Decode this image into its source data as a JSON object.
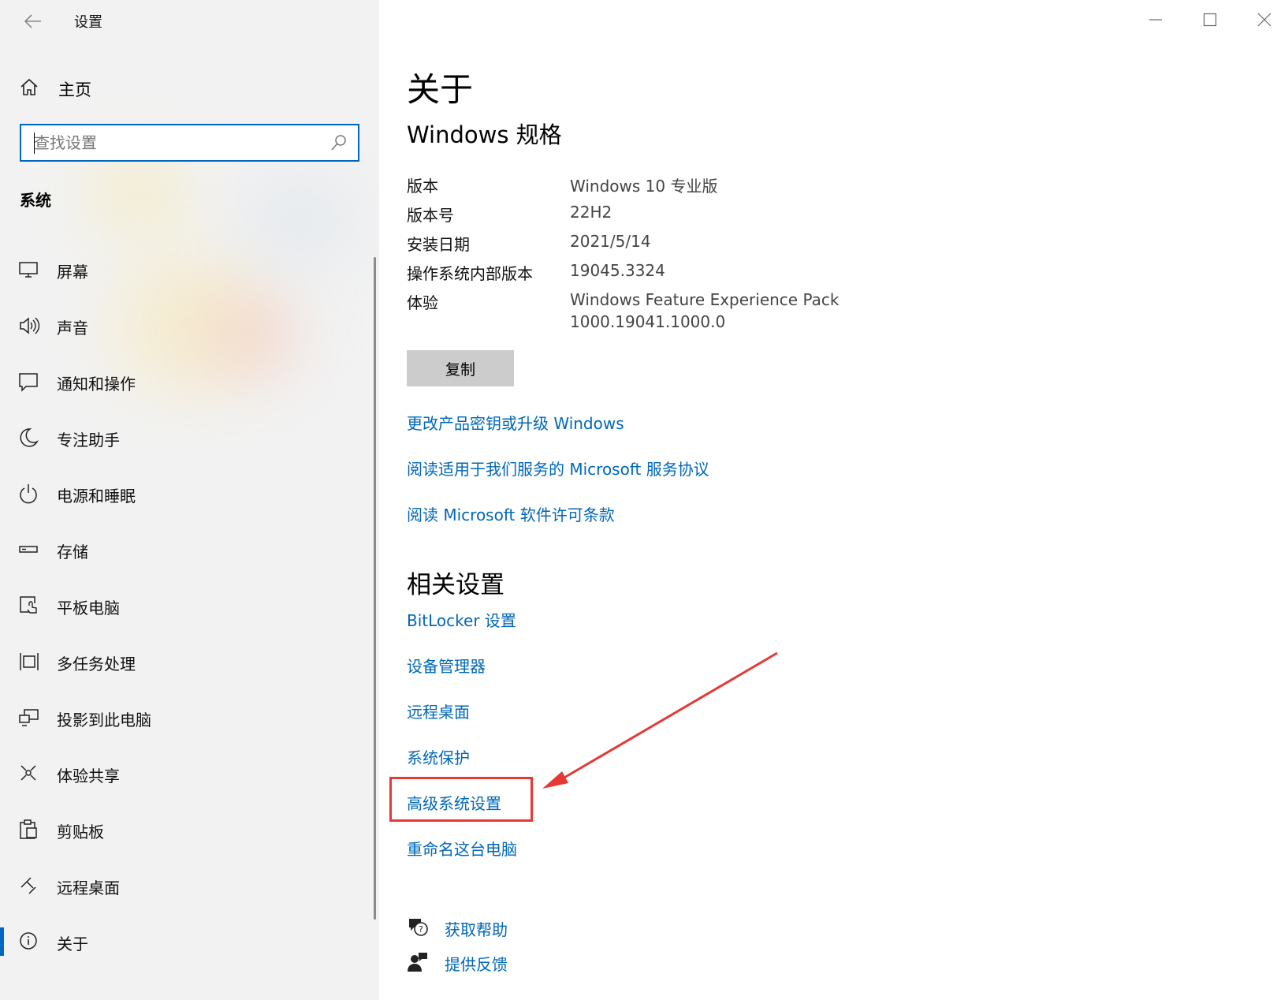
{
  "window": {
    "app_title": "设置"
  },
  "sidebar": {
    "home_label": "主页",
    "search_placeholder": "查找设置",
    "section_title": "系统",
    "items": [
      {
        "label": "屏幕",
        "icon": "monitor-icon"
      },
      {
        "label": "声音",
        "icon": "speaker-icon"
      },
      {
        "label": "通知和操作",
        "icon": "message-icon"
      },
      {
        "label": "专注助手",
        "icon": "moon-icon"
      },
      {
        "label": "电源和睡眠",
        "icon": "power-icon"
      },
      {
        "label": "存储",
        "icon": "storage-icon"
      },
      {
        "label": "平板电脑",
        "icon": "tablet-icon"
      },
      {
        "label": "多任务处理",
        "icon": "multitask-icon"
      },
      {
        "label": "投影到此电脑",
        "icon": "project-icon"
      },
      {
        "label": "体验共享",
        "icon": "share-icon"
      },
      {
        "label": "剪贴板",
        "icon": "clipboard-icon"
      },
      {
        "label": "远程桌面",
        "icon": "remote-icon"
      },
      {
        "label": "关于",
        "icon": "info-icon",
        "active": true
      }
    ]
  },
  "main": {
    "title": "关于",
    "spec_heading": "Windows 规格",
    "specs": [
      {
        "key": "版本",
        "value": "Windows 10 专业版"
      },
      {
        "key": "版本号",
        "value": "22H2"
      },
      {
        "key": "安装日期",
        "value": "2021/5/14"
      },
      {
        "key": "操作系统内部版本",
        "value": "19045.3324"
      },
      {
        "key": "体验",
        "value": "Windows Feature Experience Pack",
        "value2": "1000.19041.1000.0"
      }
    ],
    "copy_button": "复制",
    "links": [
      "更改产品密钥或升级 Windows",
      "阅读适用于我们服务的 Microsoft 服务协议",
      "阅读 Microsoft 软件许可条款"
    ],
    "related_heading": "相关设置",
    "related_links": [
      "BitLocker 设置",
      "设备管理器",
      "远程桌面",
      "系统保护",
      "高级系统设置",
      "重命名这台电脑"
    ],
    "help_links": [
      {
        "label": "获取帮助",
        "icon": "help-chat-icon"
      },
      {
        "label": "提供反馈",
        "icon": "feedback-icon"
      }
    ]
  },
  "colors": {
    "accent": "#0067c0",
    "link": "#0067b8",
    "annotation": "#e53935"
  }
}
